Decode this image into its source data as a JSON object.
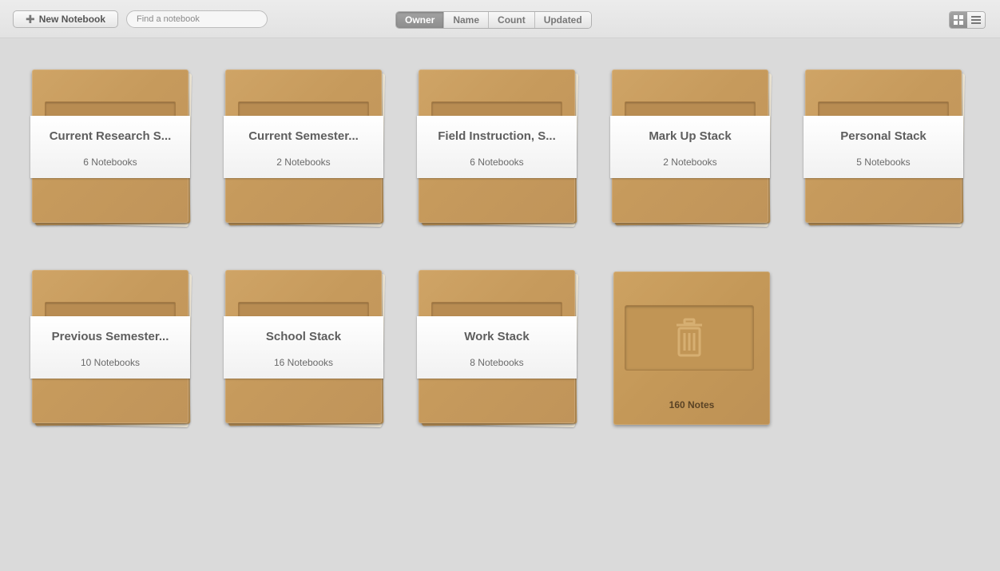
{
  "toolbar": {
    "new_notebook_label": "New Notebook",
    "search_placeholder": "Find a notebook",
    "sort_options": [
      "Owner",
      "Name",
      "Count",
      "Updated"
    ],
    "active_sort": "Owner",
    "view_modes": [
      "grid-view-icon",
      "list-view-icon"
    ],
    "active_view": "grid-view-icon"
  },
  "stacks": [
    {
      "title": "Current Research S...",
      "count": "6 Notebooks"
    },
    {
      "title": "Current Semester...",
      "count": "2 Notebooks"
    },
    {
      "title": "Field Instruction, S...",
      "count": "6 Notebooks"
    },
    {
      "title": "Mark Up Stack",
      "count": "2 Notebooks"
    },
    {
      "title": "Personal Stack",
      "count": "5 Notebooks"
    },
    {
      "title": "Previous Semester...",
      "count": "10 Notebooks"
    },
    {
      "title": "School Stack",
      "count": "16 Notebooks"
    },
    {
      "title": "Work Stack",
      "count": "8 Notebooks"
    }
  ],
  "trash": {
    "icon": "trash-icon",
    "count": "160 Notes"
  },
  "colors": {
    "kraft": "#c69a5c",
    "band": "#ffffff",
    "background": "#dadada",
    "active_segment": "#999999"
  }
}
